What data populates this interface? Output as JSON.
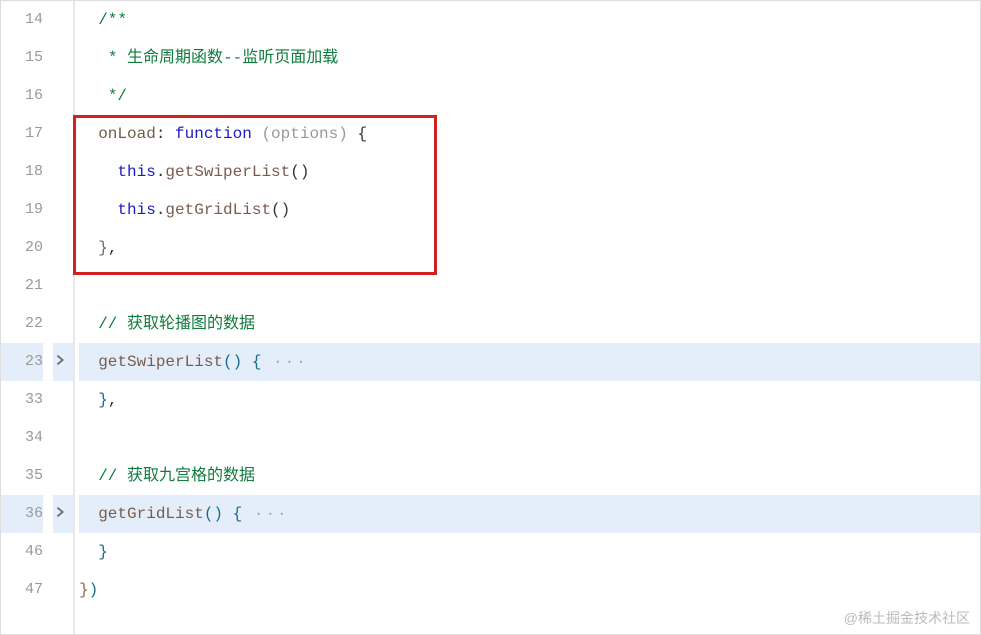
{
  "lines": [
    {
      "num": "14",
      "fold": false,
      "highlighted": false,
      "segments": [
        {
          "text": "  ",
          "class": ""
        },
        {
          "text": "/**",
          "class": "c-comment"
        }
      ]
    },
    {
      "num": "15",
      "fold": false,
      "highlighted": false,
      "segments": [
        {
          "text": "   ",
          "class": ""
        },
        {
          "text": "* 生命周期函数--监听页面加载",
          "class": "c-comment"
        }
      ]
    },
    {
      "num": "16",
      "fold": false,
      "highlighted": false,
      "segments": [
        {
          "text": "   ",
          "class": ""
        },
        {
          "text": "*/",
          "class": "c-comment"
        }
      ]
    },
    {
      "num": "17",
      "fold": false,
      "highlighted": false,
      "segments": [
        {
          "text": "  ",
          "class": ""
        },
        {
          "text": "onLoad",
          "class": "c-funcname"
        },
        {
          "text": ": ",
          "class": "c-identifier"
        },
        {
          "text": "function",
          "class": "c-keyword"
        },
        {
          "text": " ",
          "class": ""
        },
        {
          "text": "(",
          "class": "c-param"
        },
        {
          "text": "options",
          "class": "c-param"
        },
        {
          "text": ")",
          "class": "c-param"
        },
        {
          "text": " ",
          "class": ""
        },
        {
          "text": "{",
          "class": "c-brace"
        }
      ]
    },
    {
      "num": "18",
      "fold": false,
      "highlighted": false,
      "segments": [
        {
          "text": "    ",
          "class": ""
        },
        {
          "text": "this",
          "class": "c-this"
        },
        {
          "text": ".",
          "class": "c-identifier"
        },
        {
          "text": "getSwiperList",
          "class": "c-method"
        },
        {
          "text": "()",
          "class": "c-paren"
        }
      ]
    },
    {
      "num": "19",
      "fold": false,
      "highlighted": false,
      "segments": [
        {
          "text": "    ",
          "class": ""
        },
        {
          "text": "this",
          "class": "c-this"
        },
        {
          "text": ".",
          "class": "c-identifier"
        },
        {
          "text": "getGridList",
          "class": "c-method"
        },
        {
          "text": "()",
          "class": "c-paren"
        }
      ]
    },
    {
      "num": "20",
      "fold": false,
      "highlighted": false,
      "segments": [
        {
          "text": "  ",
          "class": ""
        },
        {
          "text": "}",
          "class": "c-closing"
        },
        {
          "text": ",",
          "class": "c-comma"
        }
      ]
    },
    {
      "num": "21",
      "fold": false,
      "highlighted": false,
      "segments": [
        {
          "text": "",
          "class": ""
        }
      ]
    },
    {
      "num": "22",
      "fold": false,
      "highlighted": false,
      "segments": [
        {
          "text": "  ",
          "class": ""
        },
        {
          "text": "// 获取轮播图的数据",
          "class": "c-comment"
        }
      ]
    },
    {
      "num": "23",
      "fold": true,
      "highlighted": true,
      "segments": [
        {
          "text": "  ",
          "class": ""
        },
        {
          "text": "getSwiperList",
          "class": "c-method"
        },
        {
          "text": "()",
          "class": "c-fold-brace"
        },
        {
          "text": " ",
          "class": ""
        },
        {
          "text": "{",
          "class": "c-fold-brace"
        },
        {
          "text": " ···",
          "class": "c-ellipsis"
        }
      ]
    },
    {
      "num": "33",
      "fold": false,
      "highlighted": false,
      "segments": [
        {
          "text": "  ",
          "class": ""
        },
        {
          "text": "}",
          "class": "c-fold-brace"
        },
        {
          "text": ",",
          "class": "c-comma"
        }
      ]
    },
    {
      "num": "34",
      "fold": false,
      "highlighted": false,
      "segments": [
        {
          "text": "",
          "class": ""
        }
      ]
    },
    {
      "num": "35",
      "fold": false,
      "highlighted": false,
      "segments": [
        {
          "text": "  ",
          "class": ""
        },
        {
          "text": "// 获取九宫格的数据",
          "class": "c-comment"
        }
      ]
    },
    {
      "num": "36",
      "fold": true,
      "highlighted": true,
      "segments": [
        {
          "text": "  ",
          "class": ""
        },
        {
          "text": "getGridList",
          "class": "c-method"
        },
        {
          "text": "()",
          "class": "c-fold-brace"
        },
        {
          "text": " ",
          "class": ""
        },
        {
          "text": "{",
          "class": "c-fold-brace"
        },
        {
          "text": " ···",
          "class": "c-ellipsis"
        }
      ]
    },
    {
      "num": "46",
      "fold": false,
      "highlighted": false,
      "segments": [
        {
          "text": "  ",
          "class": ""
        },
        {
          "text": "}",
          "class": "c-fold-brace"
        }
      ]
    },
    {
      "num": "47",
      "fold": false,
      "highlighted": false,
      "segments": [
        {
          "text": "}",
          "class": "c-final-brace"
        },
        {
          "text": ")",
          "class": "c-final-paren"
        }
      ]
    }
  ],
  "watermark": "@稀土掘金技术社区"
}
